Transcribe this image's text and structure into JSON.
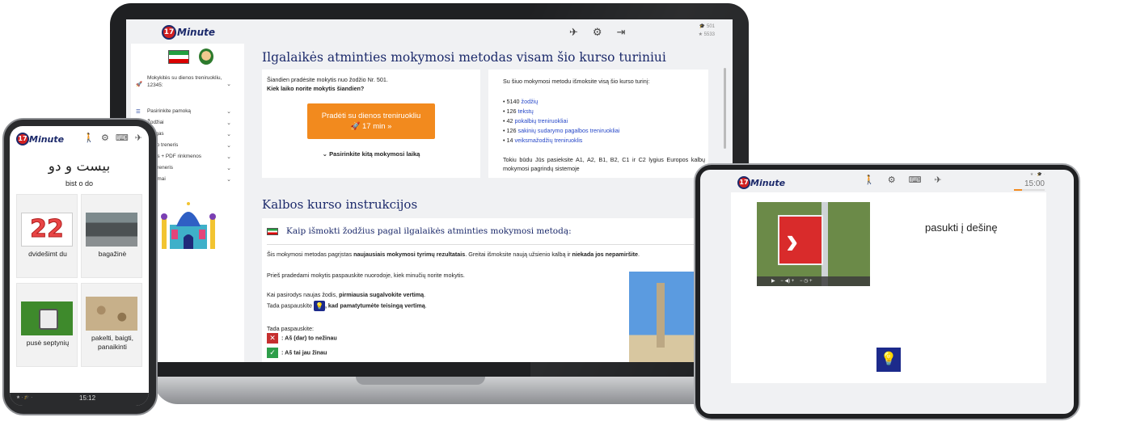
{
  "laptop": {
    "logo_text": "Minute",
    "logo_number": "17",
    "stats": [
      "501",
      "5533"
    ],
    "sidebar": {
      "items": [
        {
          "label": "Mokykitės su dienos treniruokliu, 12345:"
        },
        {
          "label": "Pasirinkite pamoką"
        },
        {
          "label": "Žodžiai"
        },
        {
          "label": "...logas"
        },
        {
          "label": "...lbio treneris"
        },
        {
          "label": "...eris + PDF rinkmenos"
        },
        {
          "label": "...p treneris"
        },
        {
          "label": "...domai"
        }
      ]
    },
    "title": "Ilgalaikės atminties mokymosi metodas visam šio kurso turiniui",
    "card1": {
      "line1": "Šiandien pradėsite mokytis nuo žodžio Nr. 501.",
      "line2": "Kiek laiko norite mokytis šiandien?",
      "button_line1": "Pradėti su dienos treniruokliu",
      "button_line2": "17 min »",
      "other_time": "Pasirinkite kitą mokymosi laiką"
    },
    "card2": {
      "intro": "Su šiuo mokymosi metodu išmoksite visą šio kurso turinį:",
      "items": [
        {
          "count": "5140",
          "label": "žodžių"
        },
        {
          "count": "126",
          "label": "tekstų"
        },
        {
          "count": "42",
          "label": "pokalbių treniruokliai"
        },
        {
          "count": "126",
          "label": "sakinių sudarymo pagalbos treniruokliai"
        },
        {
          "count": "14",
          "label": "veiksmažodžių treniruoklis"
        }
      ],
      "outro": "Tokiu būdu Jūs pasieksite A1, A2, B1, B2, C1 ir C2 lygius Europos kalbų mokymosi pagrindų sistemoje"
    },
    "title2": "Kalbos kurso instrukcijos",
    "card3": {
      "subtitle": "Kaip išmokti žodžius pagal ilgalaikės atminties mokymosi metodą:",
      "p1_a": "Šis mokymosi metodas pagrįstas ",
      "p1_b": "naujausiais mokymosi tyrimų rezultatais",
      "p1_c": ". Greitai išmoksite naują užsienio kalbą ir ",
      "p1_d": "niekada jos nepamiršite",
      "p1_e": ".",
      "p2": "Prieš pradedami mokytis paspauskite nuorodoje, kiek minučių norite mokytis.",
      "p3_a": "Kai pasirodys naujas žodis, ",
      "p3_b": "pirmiausia sugalvokite vertimą",
      "p3_c": ".",
      "p4_a": "Tada paspauskite ",
      "p4_b": ", kad pamatytumėte teisingą vertimą",
      "p4_c": ".",
      "p5": "Tada paspauskite:",
      "p6": ": Aš (dar) to nežinau",
      "p7": ": Aš tai jau žinau"
    }
  },
  "phone": {
    "logo_text": "Minute",
    "logo_number": "17",
    "word": "بیست و دو",
    "transliteration": "bist o do",
    "tiles": [
      {
        "caption": "dvidešimt du",
        "image_text": "22"
      },
      {
        "caption": "bagažinė"
      },
      {
        "caption": "pusė septynių"
      },
      {
        "caption": "pakelti, baigti, panaikinti"
      }
    ],
    "time": "15:12"
  },
  "tablet": {
    "logo_text": "Minute",
    "logo_number": "17",
    "time": "15:00",
    "phrase": "pasukti į dešinę"
  },
  "colors": {
    "brand_navy": "#1c2a6b",
    "accent_orange": "#f28a1e",
    "link_blue": "#2748c8"
  }
}
